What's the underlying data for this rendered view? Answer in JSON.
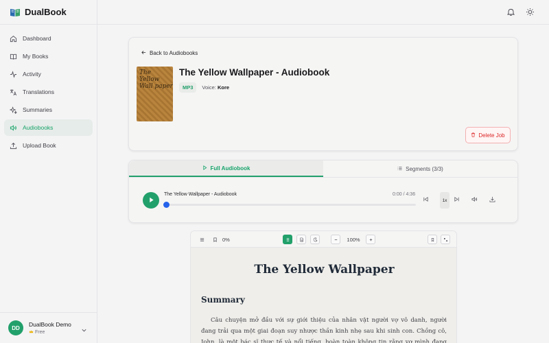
{
  "app": {
    "name": "DualBook"
  },
  "sidebar": {
    "items": [
      {
        "label": "Dashboard",
        "icon": "home-icon",
        "active": false
      },
      {
        "label": "My Books",
        "icon": "book-icon",
        "active": false
      },
      {
        "label": "Activity",
        "icon": "activity-icon",
        "active": false
      },
      {
        "label": "Translations",
        "icon": "translate-icon",
        "active": false
      },
      {
        "label": "Summaries",
        "icon": "sparkles-icon",
        "active": false
      },
      {
        "label": "Audiobooks",
        "icon": "speaker-icon",
        "active": true
      },
      {
        "label": "Upload Book",
        "icon": "upload-icon",
        "active": false
      }
    ]
  },
  "user": {
    "initials": "DD",
    "name": "DualBook Demo",
    "plan": "Free"
  },
  "header": {
    "back_label": "Back to Audiobooks",
    "cover_text": "The Yellow Wall paper",
    "title": "The Yellow Wallpaper - Audiobook",
    "format_badge": "MP3",
    "voice_label": "Voice:",
    "voice_name": "Kore",
    "delete_label": "Delete Job"
  },
  "player": {
    "tabs": [
      {
        "label": "Full Audiobook",
        "active": true
      },
      {
        "label": "Segments (3/3)",
        "active": false
      }
    ],
    "track_name": "The Yellow Wallpaper - Audiobook",
    "time": "0:00 / 4:36",
    "progress": 0,
    "speed": "1x"
  },
  "reader": {
    "progress_label": "0%",
    "zoom_label": "100%",
    "book_title": "The Yellow Wallpaper",
    "section_heading": "Summary",
    "paragraph": "Câu chuyện mở đầu với sự giới thiệu của nhân vật người vợ vô danh, người đang trải qua một giai đoạn suy nhược thần kinh nhẹ sau khi sinh con. Chồng cô, John, là một bác sĩ thực tế và nổi tiếng, hoàn toàn không tin rằng vợ mình đang mắc bệnh thực sự. Anh coi"
  },
  "colors": {
    "accent": "#22a06b",
    "danger": "#dc2626",
    "progress": "#2563eb"
  }
}
